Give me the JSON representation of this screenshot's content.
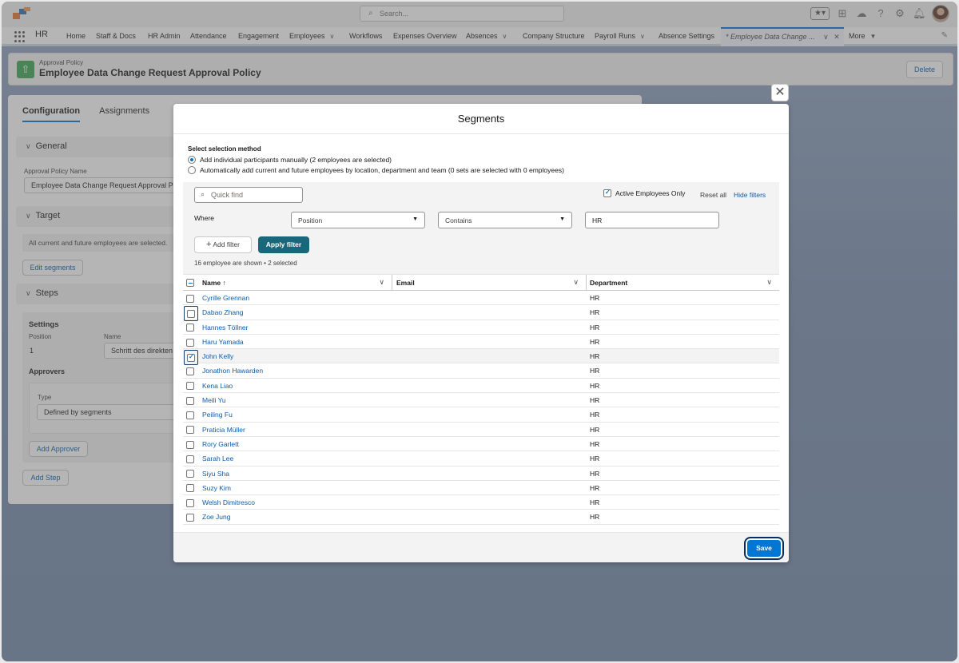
{
  "header": {
    "search_placeholder": "Search...",
    "icons": [
      "favorites-icon",
      "add-icon",
      "trailhead-icon",
      "help-icon",
      "setup-icon",
      "notifications-icon",
      "avatar"
    ]
  },
  "nav": {
    "app_name": "HR",
    "items": [
      "Home",
      "Staff & Docs",
      "HR Admin",
      "Attendance",
      "Engagement",
      "Employees",
      "Workflows",
      "Expenses Overview",
      "Absences",
      "Company Structure",
      "Payroll Runs",
      "Absence Settings"
    ],
    "active_tab": "* Employee Data Change ...",
    "more": "More"
  },
  "record": {
    "object_label": "Approval Policy",
    "title": "Employee Data Change Request Approval Policy",
    "delete_label": "Delete"
  },
  "panel": {
    "tabs": [
      "Configuration",
      "Assignments"
    ],
    "general_label": "General",
    "policy_name_label": "Approval Policy Name",
    "policy_name_value": "Employee Data Change Request Approval Policy",
    "target_label": "Target",
    "target_info": "All current and future employees are selected.",
    "edit_segments_label": "Edit segments",
    "steps_label": "Steps",
    "settings_label": "Settings",
    "position_label": "Position",
    "position_value": "1",
    "name_label": "Name",
    "name_value": "Schritt des direkten Vorgesetzten",
    "approvers_label": "Approvers",
    "type_label": "Type",
    "type_value": "Defined by segments",
    "add_approver_label": "Add Approver",
    "add_step_label": "Add Step"
  },
  "modal": {
    "title": "Segments",
    "selection_header": "Select selection method",
    "option_manual": "Add individual participants manually (2 employees are selected)",
    "option_auto": "Automatically add current and future employees by location, department and team (0 sets are selected with 0 employees)",
    "quick_find_placeholder": "Quick find",
    "active_only_label": "Active Employees Only",
    "active_only_checked": true,
    "reset_label": "Reset all",
    "hide_filters_label": "Hide filters",
    "where_label": "Where",
    "filter_field": "Position",
    "filter_operator": "Contains",
    "filter_value": "HR",
    "add_filter_label": "Add filter",
    "apply_filter_label": "Apply filter",
    "shown_text": "16 employee are shown • 2 selected",
    "columns": [
      "Name ↑",
      "Email",
      "Department"
    ],
    "rows": [
      {
        "name": "Cyrille Grennan",
        "dept": "HR",
        "checked": false
      },
      {
        "name": "Dabao Zhang",
        "dept": "HR",
        "checked": false
      },
      {
        "name": "Hannes Töllner",
        "dept": "HR",
        "checked": false
      },
      {
        "name": "Haru Yamada",
        "dept": "HR",
        "checked": false
      },
      {
        "name": "John Kelly",
        "dept": "HR",
        "checked": true
      },
      {
        "name": "Jonathon Hawarden",
        "dept": "HR",
        "checked": false
      },
      {
        "name": "Kena Liao",
        "dept": "HR",
        "checked": false
      },
      {
        "name": "Meili Yu",
        "dept": "HR",
        "checked": false
      },
      {
        "name": "Peiling Fu",
        "dept": "HR",
        "checked": false
      },
      {
        "name": "Praticia Müller",
        "dept": "HR",
        "checked": false
      },
      {
        "name": "Rory Garlett",
        "dept": "HR",
        "checked": false
      },
      {
        "name": "Sarah Lee",
        "dept": "HR",
        "checked": false
      },
      {
        "name": "Siyu Sha",
        "dept": "HR",
        "checked": false
      },
      {
        "name": "Suzy Kim",
        "dept": "HR",
        "checked": false
      },
      {
        "name": "Welsh Dimitresco",
        "dept": "HR",
        "checked": false
      },
      {
        "name": "Zoe Jung",
        "dept": "HR",
        "checked": false
      }
    ],
    "save_label": "Save"
  }
}
